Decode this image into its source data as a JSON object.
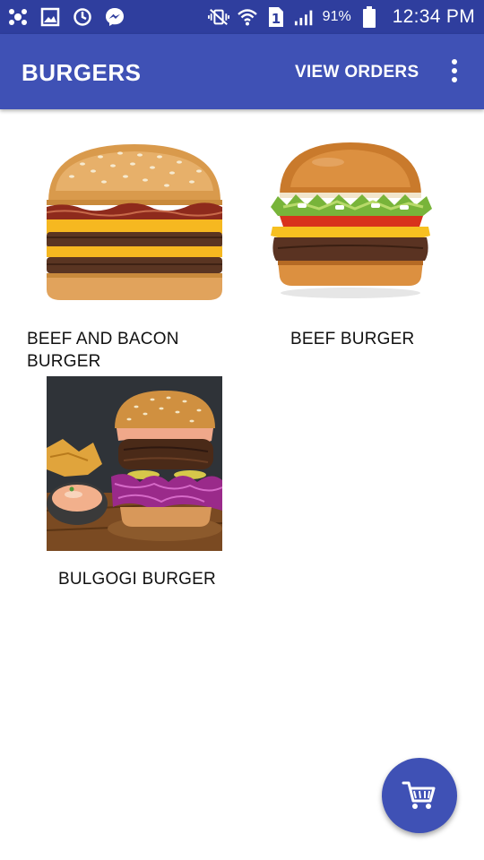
{
  "status_bar": {
    "battery_percent": "91%",
    "time": "12:34 PM",
    "sim_slot": "1",
    "icons": [
      "app-notification-icon",
      "gallery-icon",
      "sync-icon",
      "messenger-icon",
      "vibrate-mute-icon",
      "wifi-icon",
      "sim-icon",
      "signal-icon",
      "battery-icon"
    ]
  },
  "app_bar": {
    "title": "BURGERS",
    "view_orders_label": "VIEW ORDERS",
    "overflow_icon": "more-vert-icon",
    "color": "#3f51b5",
    "status_color": "#2f3e9e"
  },
  "products": [
    {
      "label": "BEEF AND BACON BURGER",
      "image": "beef-and-bacon-burger-image"
    },
    {
      "label": "BEEF BURGER",
      "image": "beef-burger-image"
    },
    {
      "label": "BULGOGI BURGER",
      "image": "bulgogi-burger-image"
    }
  ],
  "fab": {
    "icon": "shopping-cart-icon",
    "color": "#3f51b5"
  }
}
